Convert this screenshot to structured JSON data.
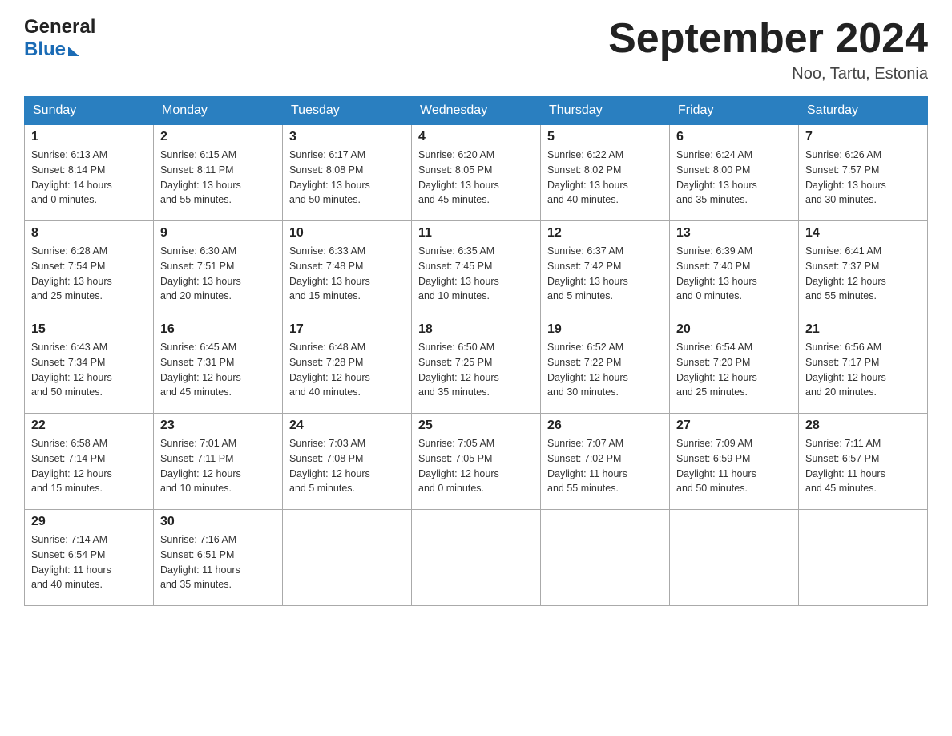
{
  "header": {
    "logo_general": "General",
    "logo_blue": "Blue",
    "month_title": "September 2024",
    "location": "Noo, Tartu, Estonia"
  },
  "calendar": {
    "days_of_week": [
      "Sunday",
      "Monday",
      "Tuesday",
      "Wednesday",
      "Thursday",
      "Friday",
      "Saturday"
    ],
    "weeks": [
      [
        {
          "day": 1,
          "sunrise": "6:13 AM",
          "sunset": "8:14 PM",
          "daylight": "14 hours and 0 minutes."
        },
        {
          "day": 2,
          "sunrise": "6:15 AM",
          "sunset": "8:11 PM",
          "daylight": "13 hours and 55 minutes."
        },
        {
          "day": 3,
          "sunrise": "6:17 AM",
          "sunset": "8:08 PM",
          "daylight": "13 hours and 50 minutes."
        },
        {
          "day": 4,
          "sunrise": "6:20 AM",
          "sunset": "8:05 PM",
          "daylight": "13 hours and 45 minutes."
        },
        {
          "day": 5,
          "sunrise": "6:22 AM",
          "sunset": "8:02 PM",
          "daylight": "13 hours and 40 minutes."
        },
        {
          "day": 6,
          "sunrise": "6:24 AM",
          "sunset": "8:00 PM",
          "daylight": "13 hours and 35 minutes."
        },
        {
          "day": 7,
          "sunrise": "6:26 AM",
          "sunset": "7:57 PM",
          "daylight": "13 hours and 30 minutes."
        }
      ],
      [
        {
          "day": 8,
          "sunrise": "6:28 AM",
          "sunset": "7:54 PM",
          "daylight": "13 hours and 25 minutes."
        },
        {
          "day": 9,
          "sunrise": "6:30 AM",
          "sunset": "7:51 PM",
          "daylight": "13 hours and 20 minutes."
        },
        {
          "day": 10,
          "sunrise": "6:33 AM",
          "sunset": "7:48 PM",
          "daylight": "13 hours and 15 minutes."
        },
        {
          "day": 11,
          "sunrise": "6:35 AM",
          "sunset": "7:45 PM",
          "daylight": "13 hours and 10 minutes."
        },
        {
          "day": 12,
          "sunrise": "6:37 AM",
          "sunset": "7:42 PM",
          "daylight": "13 hours and 5 minutes."
        },
        {
          "day": 13,
          "sunrise": "6:39 AM",
          "sunset": "7:40 PM",
          "daylight": "13 hours and 0 minutes."
        },
        {
          "day": 14,
          "sunrise": "6:41 AM",
          "sunset": "7:37 PM",
          "daylight": "12 hours and 55 minutes."
        }
      ],
      [
        {
          "day": 15,
          "sunrise": "6:43 AM",
          "sunset": "7:34 PM",
          "daylight": "12 hours and 50 minutes."
        },
        {
          "day": 16,
          "sunrise": "6:45 AM",
          "sunset": "7:31 PM",
          "daylight": "12 hours and 45 minutes."
        },
        {
          "day": 17,
          "sunrise": "6:48 AM",
          "sunset": "7:28 PM",
          "daylight": "12 hours and 40 minutes."
        },
        {
          "day": 18,
          "sunrise": "6:50 AM",
          "sunset": "7:25 PM",
          "daylight": "12 hours and 35 minutes."
        },
        {
          "day": 19,
          "sunrise": "6:52 AM",
          "sunset": "7:22 PM",
          "daylight": "12 hours and 30 minutes."
        },
        {
          "day": 20,
          "sunrise": "6:54 AM",
          "sunset": "7:20 PM",
          "daylight": "12 hours and 25 minutes."
        },
        {
          "day": 21,
          "sunrise": "6:56 AM",
          "sunset": "7:17 PM",
          "daylight": "12 hours and 20 minutes."
        }
      ],
      [
        {
          "day": 22,
          "sunrise": "6:58 AM",
          "sunset": "7:14 PM",
          "daylight": "12 hours and 15 minutes."
        },
        {
          "day": 23,
          "sunrise": "7:01 AM",
          "sunset": "7:11 PM",
          "daylight": "12 hours and 10 minutes."
        },
        {
          "day": 24,
          "sunrise": "7:03 AM",
          "sunset": "7:08 PM",
          "daylight": "12 hours and 5 minutes."
        },
        {
          "day": 25,
          "sunrise": "7:05 AM",
          "sunset": "7:05 PM",
          "daylight": "12 hours and 0 minutes."
        },
        {
          "day": 26,
          "sunrise": "7:07 AM",
          "sunset": "7:02 PM",
          "daylight": "11 hours and 55 minutes."
        },
        {
          "day": 27,
          "sunrise": "7:09 AM",
          "sunset": "6:59 PM",
          "daylight": "11 hours and 50 minutes."
        },
        {
          "day": 28,
          "sunrise": "7:11 AM",
          "sunset": "6:57 PM",
          "daylight": "11 hours and 45 minutes."
        }
      ],
      [
        {
          "day": 29,
          "sunrise": "7:14 AM",
          "sunset": "6:54 PM",
          "daylight": "11 hours and 40 minutes."
        },
        {
          "day": 30,
          "sunrise": "7:16 AM",
          "sunset": "6:51 PM",
          "daylight": "11 hours and 35 minutes."
        },
        null,
        null,
        null,
        null,
        null
      ]
    ]
  }
}
